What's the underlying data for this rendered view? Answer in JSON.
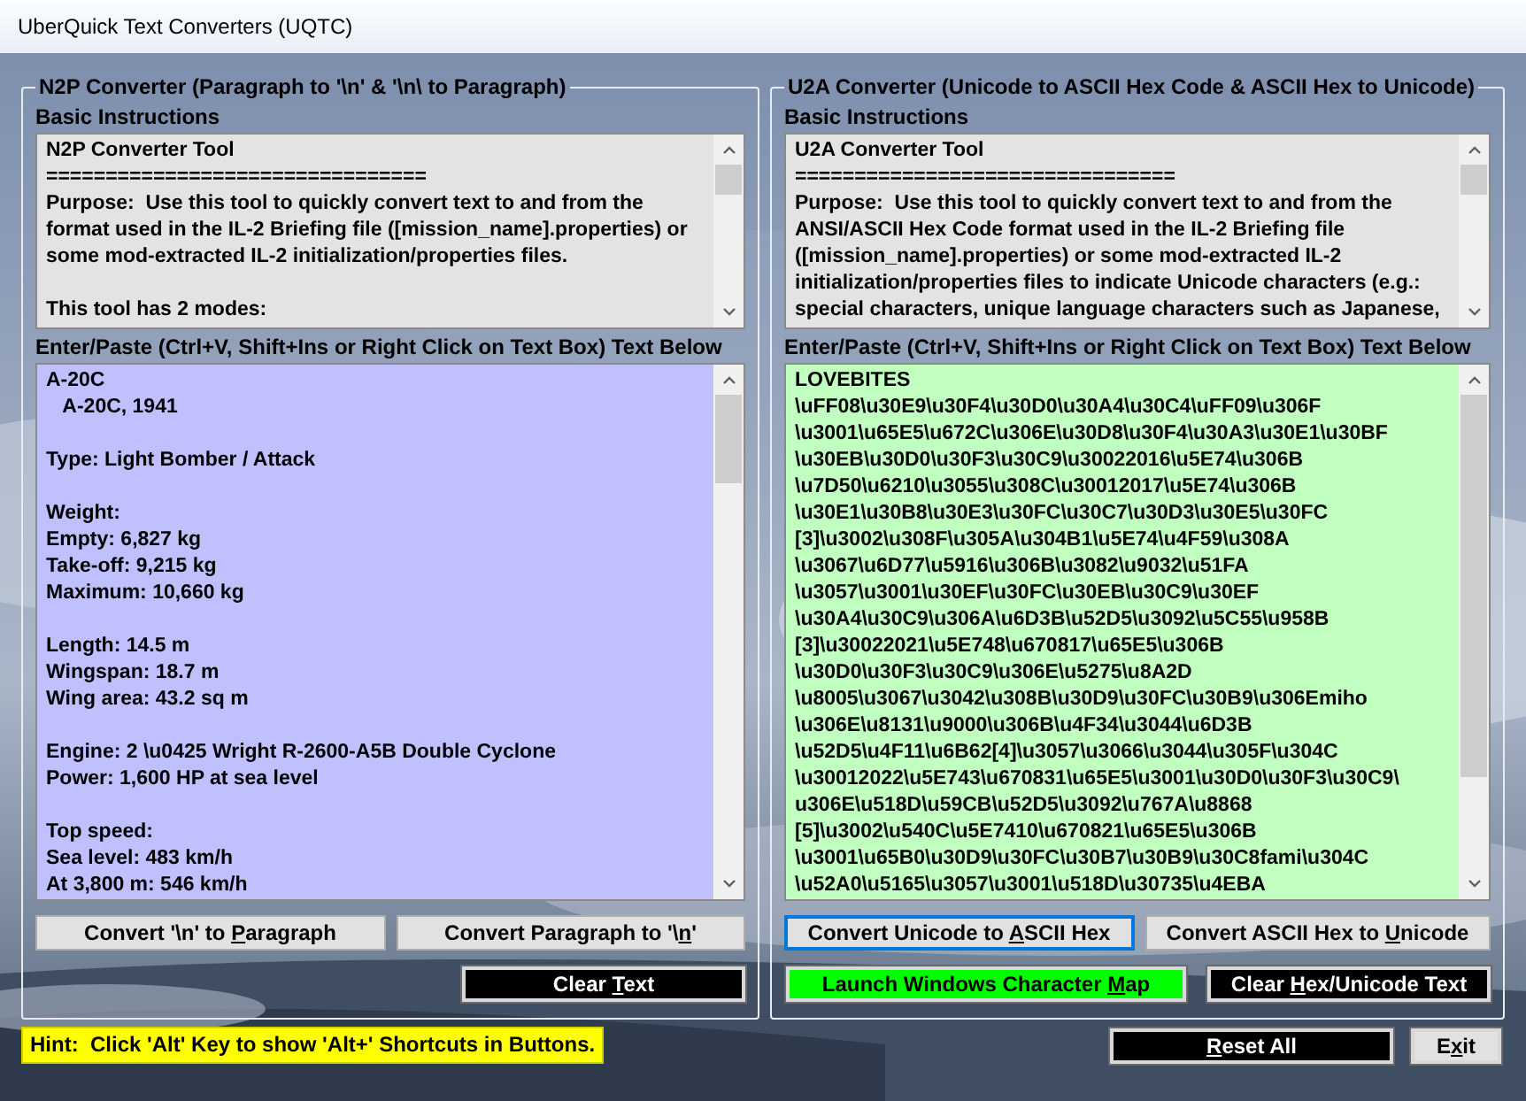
{
  "window": {
    "title": "UberQuick Text Converters (UQTC)"
  },
  "panels": [
    {
      "legend": "N2P Converter (Paragraph to '\\n' & '\\n\\ to Paragraph)",
      "instructions_label": "Basic Instructions",
      "instructions": "N2P Converter Tool\n================================\nPurpose:  Use this tool to quickly convert text to and from the\nformat used in the IL-2 Briefing file ([mission_name].properties) or\nsome mod-extracted IL-2 initialization/properties files.\n\nThis tool has 2 modes:",
      "input_label": "Enter/Paste (Ctrl+V, Shift+Ins or Right Click on Text Box) Text Below",
      "input_value": "A-20C\n   A-20C, 1941\n\nType: Light Bomber / Attack\n\nWeight:\nEmpty: 6,827 kg\nTake-off: 9,215 kg\nMaximum: 10,660 kg\n\nLength: 14.5 m\nWingspan: 18.7 m\nWing area: 43.2 sq m\n\nEngine: 2 \\u0425 Wright R-2600-A5B Double Cyclone\nPower: 1,600 HP at sea level\n\nTop speed:\nSea level: 483 km/h\nAt 3,800 m: 546 km/h",
      "kind": "n2p",
      "convert_buttons": [
        {
          "pre": "Convert '\\n' to ",
          "key": "P",
          "post": "aragraph",
          "focused": false
        },
        {
          "pre": "Convert Paragraph to '\\",
          "key": "n",
          "post": "'",
          "focused": false
        }
      ],
      "action_buttons": [
        {
          "pre": "Clear ",
          "key": "T",
          "post": "ext",
          "color": "#000000"
        }
      ]
    },
    {
      "legend": "U2A Converter (Unicode to ASCII Hex Code & ASCII Hex to Unicode)",
      "instructions_label": "Basic Instructions",
      "instructions": "U2A Converter Tool\n================================\nPurpose:  Use this tool to quickly convert text to and from the\nANSI/ASCII Hex Code format used in the IL-2 Briefing file\n([mission_name].properties) or some mod-extracted IL-2\ninitialization/properties files to indicate Unicode characters (e.g.:\nspecial characters, unique language characters such as Japanese,",
      "input_label": "Enter/Paste (Ctrl+V, Shift+Ins or Right Click on Text Box) Text Below",
      "input_value": "LOVEBITES\n\\uFF08\\u30E9\\u30F4\\u30D0\\u30A4\\u30C4\\uFF09\\u306F\n\\u3001\\u65E5\\u672C\\u306E\\u30D8\\u30F4\\u30A3\\u30E1\\u30BF\n\\u30EB\\u30D0\\u30F3\\u30C9\\u30022016\\u5E74\\u306B\n\\u7D50\\u6210\\u3055\\u308C\\u30012017\\u5E74\\u306B\n\\u30E1\\u30B8\\u30E3\\u30FC\\u30C7\\u30D3\\u30E5\\u30FC\n[3]\\u3002\\u308F\\u305A\\u304B1\\u5E74\\u4F59\\u308A\n\\u3067\\u6D77\\u5916\\u306B\\u3082\\u9032\\u51FA\n\\u3057\\u3001\\u30EF\\u30FC\\u30EB\\u30C9\\u30EF\n\\u30A4\\u30C9\\u306A\\u6D3B\\u52D5\\u3092\\u5C55\\u958B\n[3]\\u30022021\\u5E748\\u670817\\u65E5\\u306B\n\\u30D0\\u30F3\\u30C9\\u306E\\u5275\\u8A2D\n\\u8005\\u3067\\u3042\\u308B\\u30D9\\u30FC\\u30B9\\u306Emiho\n\\u306E\\u8131\\u9000\\u306B\\u4F34\\u3044\\u6D3B\n\\u52D5\\u4F11\\u6B62[4]\\u3057\\u3066\\u3044\\u305F\\u304C\n\\u30012022\\u5E743\\u670831\\u65E5\\u3001\\u30D0\\u30F3\\u30C9\\\nu306E\\u518D\\u59CB\\u52D5\\u3092\\u767A\\u8868\n[5]\\u3002\\u540C\\u5E7410\\u670821\\u65E5\\u306B\n\\u3001\\u65B0\\u30D9\\u30FC\\u30B7\\u30B9\\u30C8fami\\u304C\n\\u52A0\\u5165\\u3057\\u3001\\u518D\\u30735\\u4EBA",
      "kind": "u2a",
      "convert_buttons": [
        {
          "pre": "Convert Unicode to ",
          "key": "A",
          "post": "SCII Hex",
          "focused": true
        },
        {
          "pre": "Convert ASCII Hex to ",
          "key": "U",
          "post": "nicode",
          "focused": false
        }
      ],
      "action_buttons": [
        {
          "pre": "Launch Windows Character ",
          "key": "M",
          "post": "ap",
          "color": "#00ff00"
        },
        {
          "pre": "Clear ",
          "key": "H",
          "post": "ex/Unicode Text",
          "color": "#000000"
        }
      ]
    }
  ],
  "hint": "Hint:  Click 'Alt' Key to show 'Alt+' Shortcuts in Buttons.",
  "footer_buttons": [
    {
      "key": "R",
      "post": "eset All",
      "color": "#000000"
    },
    {
      "pre": "E",
      "key": "x",
      "post": "it",
      "color": "#e1e1e1"
    }
  ]
}
